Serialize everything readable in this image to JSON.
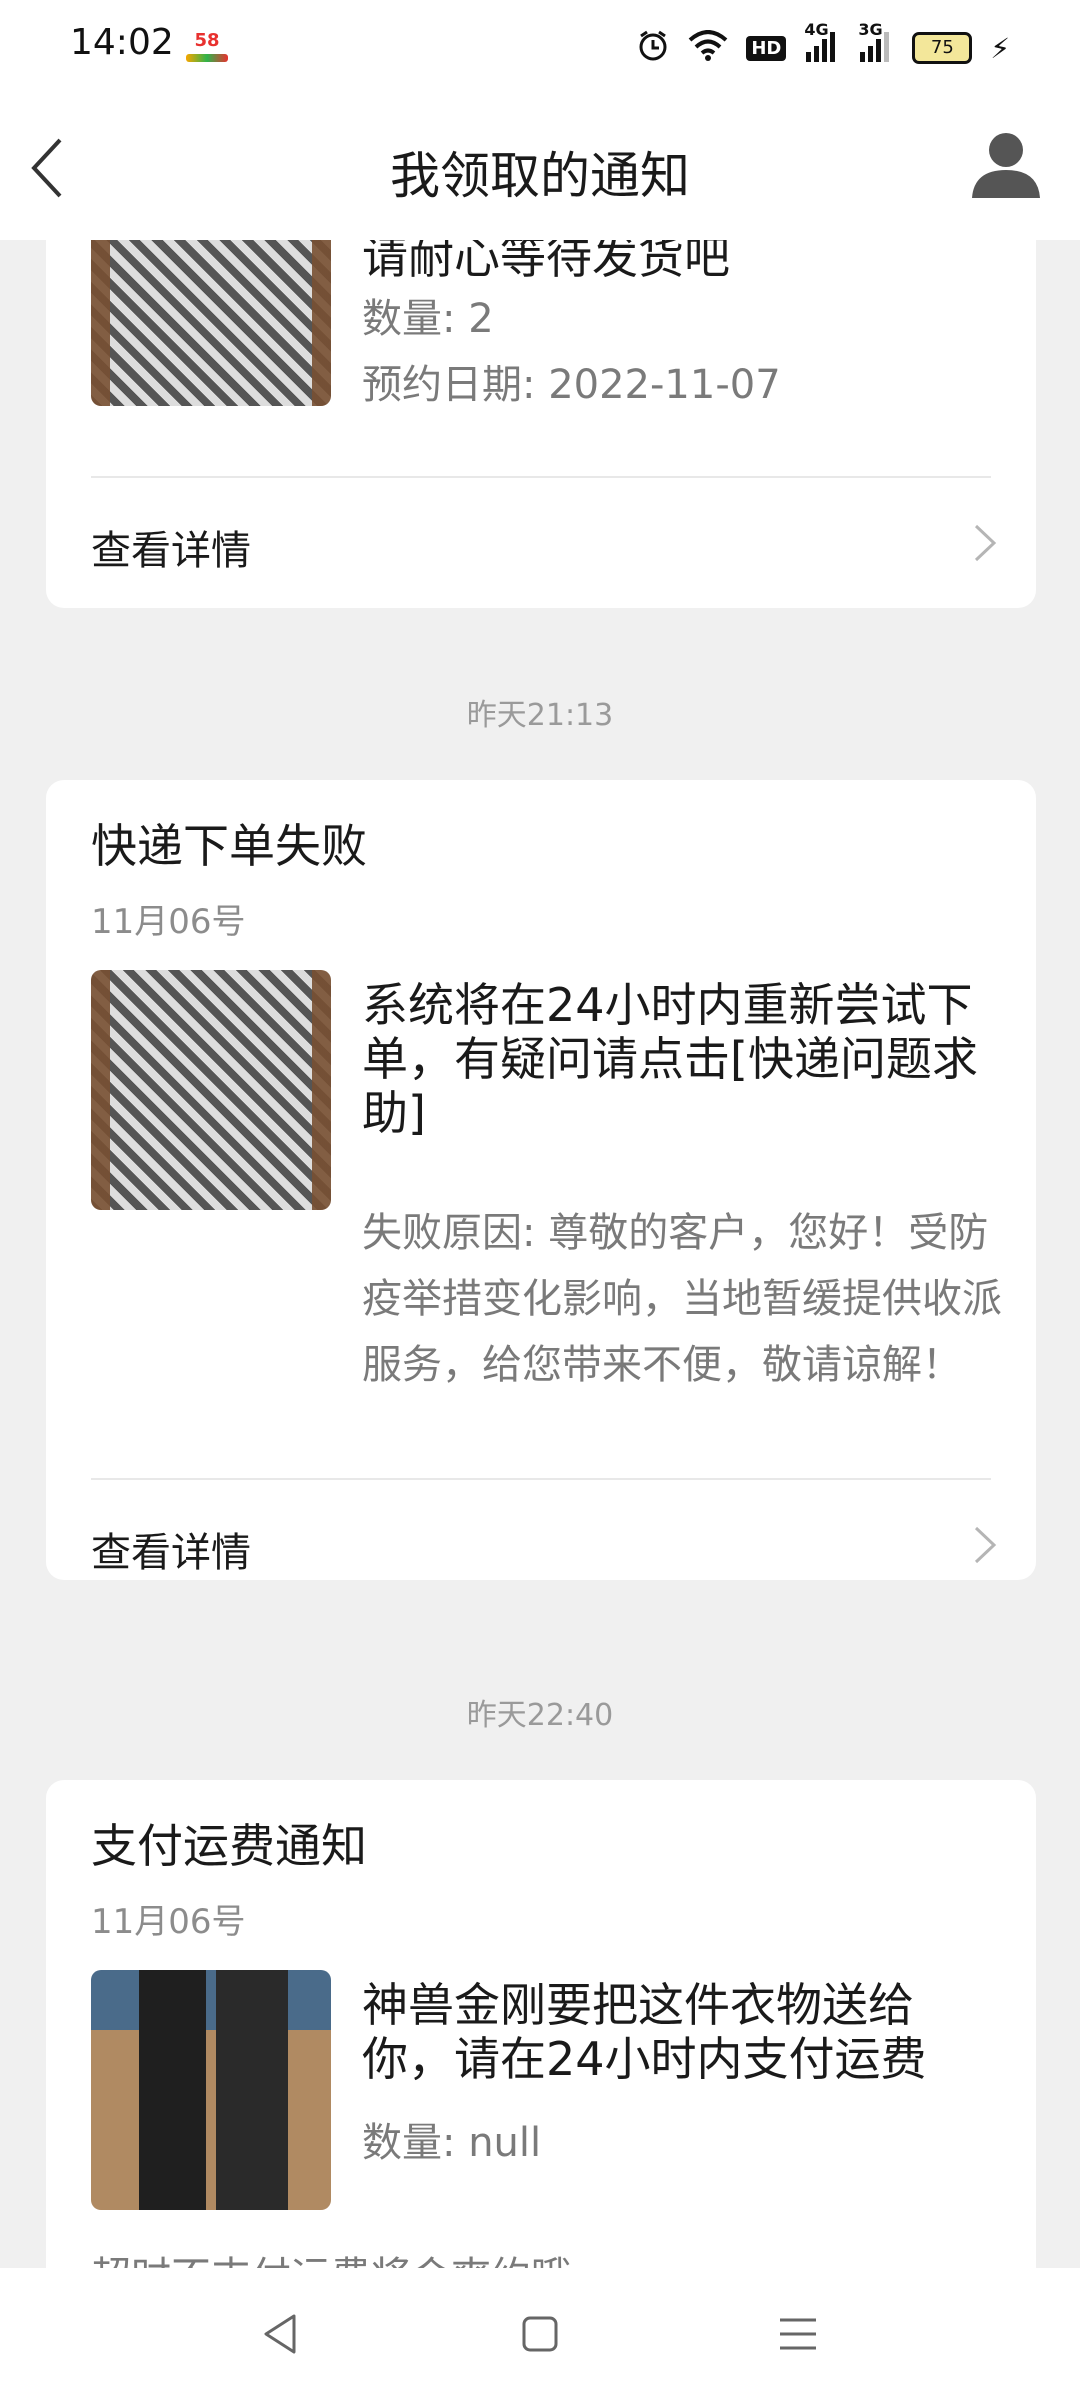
{
  "status_bar": {
    "time": "14:02",
    "app_icon": "58",
    "network_4g": "4G",
    "network_3g": "3G",
    "hd": "HD",
    "battery": "75"
  },
  "header": {
    "title": "我领取的通知",
    "back_icon": "chevron-left-icon",
    "avatar_icon": "user-avatar-icon"
  },
  "cards": [
    {
      "message": "请耐心等待发货吧",
      "quantity": "数量: 2",
      "reserve_date": "预约日期: 2022-11-07",
      "detail_label": "查看详情"
    },
    {
      "timestamp": "昨天21:13",
      "title": "快递下单失败",
      "date": "11月06号",
      "message": "系统将在24小时内重新尝试下单，有疑问请点击[快递问题求助]",
      "reason": "失败原因: 尊敬的客户，您好！受防疫举措变化影响，当地暂缓提供收派服务，给您带来不便，敬请谅解！",
      "detail_label": "查看详情"
    },
    {
      "timestamp": "昨天22:40",
      "title": "支付运费通知",
      "date": "11月06号",
      "message": "神兽金刚要把这件衣物送给你，请在24小时内支付运费",
      "quantity": "数量: null",
      "footer_note": "超时不支付运费将会爽约哦"
    }
  ],
  "colors": {
    "background": "#f0f0f0",
    "card": "#ffffff",
    "text_primary": "#1a1a1a",
    "text_secondary": "#7a7a7a"
  },
  "nav": {
    "back": "nav-back-icon",
    "home": "nav-home-icon",
    "menu": "nav-menu-icon"
  }
}
